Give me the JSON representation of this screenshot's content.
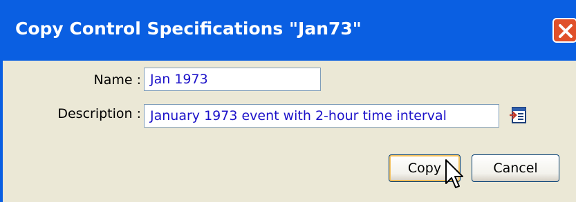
{
  "window": {
    "title": "Copy Control Specifications \"Jan73\"",
    "close_icon": "close-icon"
  },
  "form": {
    "name_label": "Name :",
    "name_value": "Jan 1973",
    "description_label": "Description :",
    "description_value": "January 1973 event with 2-hour time interval",
    "description_side_icon": "edit-text-icon"
  },
  "buttons": {
    "copy_label": "Copy",
    "cancel_label": "Cancel"
  },
  "colors": {
    "titlebar": "#0a5fe2",
    "client": "#ebe8d6",
    "field_text": "#1c12c9",
    "close": "#e0502a"
  }
}
